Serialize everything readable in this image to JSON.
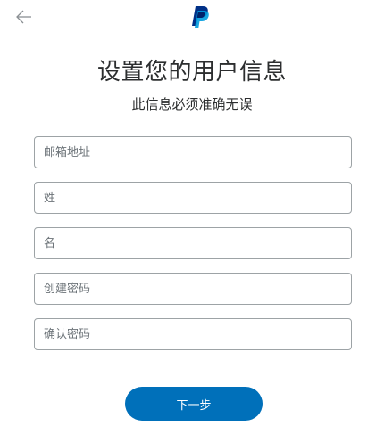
{
  "header": {
    "back_icon": "arrow-left-icon",
    "logo_icon": "paypal-logo-icon"
  },
  "main": {
    "title": "设置您的用户信息",
    "subtitle": "此信息必须准确无误"
  },
  "form": {
    "email": {
      "placeholder": "邮箱地址",
      "value": ""
    },
    "last_name": {
      "placeholder": "姓",
      "value": ""
    },
    "first_name": {
      "placeholder": "名",
      "value": ""
    },
    "password": {
      "placeholder": "创建密码",
      "value": ""
    },
    "confirm_password": {
      "placeholder": "确认密码",
      "value": ""
    }
  },
  "actions": {
    "next_label": "下一步"
  },
  "colors": {
    "accent": "#0070ba",
    "logo_dark": "#003087",
    "logo_light": "#009cde",
    "text": "#2c2e2f",
    "border": "#9da3a6"
  }
}
